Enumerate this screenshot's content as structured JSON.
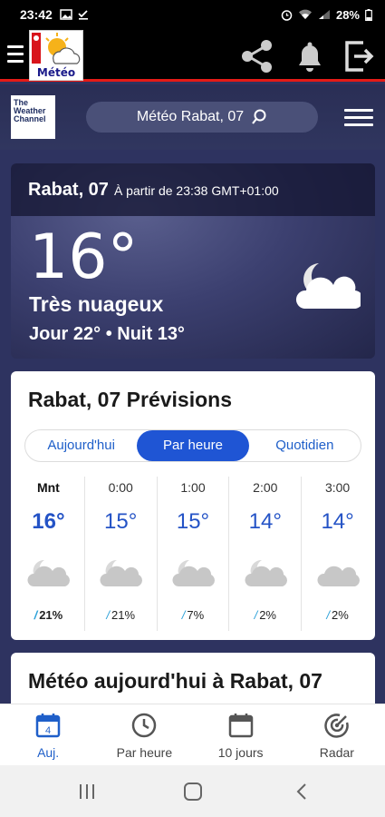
{
  "status_bar": {
    "time": "23:42",
    "battery": "28%"
  },
  "app_bar": {
    "logo_text": "Météo"
  },
  "twc": {
    "logo_lines": [
      "The",
      "Weather",
      "Channel"
    ],
    "search_label": "Météo Rabat, 07"
  },
  "current": {
    "city": "Rabat, 07",
    "as_of": "À partir de 23:38 GMT+01:00",
    "temperature": "16°",
    "phrase": "Très nuageux",
    "day_night": "Jour 22° • Nuit 13°"
  },
  "forecast": {
    "title": "Rabat, 07 Prévisions",
    "tabs": [
      {
        "label": "Aujourd'hui",
        "active": false
      },
      {
        "label": "Par heure",
        "active": true
      },
      {
        "label": "Quotidien",
        "active": false
      }
    ],
    "hours": [
      {
        "label": "Mnt",
        "temp": "16°",
        "icon": "partly-cloudy-night-icon",
        "precip": "21%"
      },
      {
        "label": "0:00",
        "temp": "15°",
        "icon": "partly-cloudy-night-icon",
        "precip": "21%"
      },
      {
        "label": "1:00",
        "temp": "15°",
        "icon": "partly-cloudy-night-icon",
        "precip": "7%"
      },
      {
        "label": "2:00",
        "temp": "14°",
        "icon": "partly-cloudy-night-icon",
        "precip": "2%"
      },
      {
        "label": "3:00",
        "temp": "14°",
        "icon": "cloudy-icon",
        "precip": "2%"
      }
    ]
  },
  "today": {
    "title": "Météo aujourd'hui à Rabat, 07"
  },
  "bottom_nav": {
    "items": [
      {
        "label": "Auj.",
        "icon": "calendar-day-icon",
        "active": true,
        "badge": "4"
      },
      {
        "label": "Par heure",
        "icon": "clock-icon",
        "active": false
      },
      {
        "label": "10 jours",
        "icon": "calendar-icon",
        "active": false
      },
      {
        "label": "Radar",
        "icon": "radar-icon",
        "active": false
      }
    ]
  },
  "colors": {
    "accent": "#1f55d4",
    "app_bar_border": "#e41b17",
    "background": "#2e3360"
  }
}
